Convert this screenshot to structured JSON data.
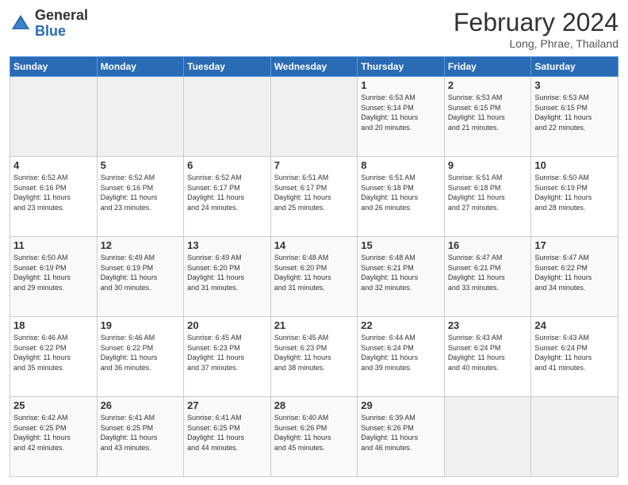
{
  "header": {
    "logo_general": "General",
    "logo_blue": "Blue",
    "month_title": "February 2024",
    "location": "Long, Phrae, Thailand"
  },
  "days_of_week": [
    "Sunday",
    "Monday",
    "Tuesday",
    "Wednesday",
    "Thursday",
    "Friday",
    "Saturday"
  ],
  "weeks": [
    [
      {
        "day": "",
        "info": "",
        "empty": true
      },
      {
        "day": "",
        "info": "",
        "empty": true
      },
      {
        "day": "",
        "info": "",
        "empty": true
      },
      {
        "day": "",
        "info": "",
        "empty": true
      },
      {
        "day": "1",
        "info": "Sunrise: 6:53 AM\nSunset: 6:14 PM\nDaylight: 11 hours\nand 20 minutes."
      },
      {
        "day": "2",
        "info": "Sunrise: 6:53 AM\nSunset: 6:15 PM\nDaylight: 11 hours\nand 21 minutes."
      },
      {
        "day": "3",
        "info": "Sunrise: 6:53 AM\nSunset: 6:15 PM\nDaylight: 11 hours\nand 22 minutes."
      }
    ],
    [
      {
        "day": "4",
        "info": "Sunrise: 6:52 AM\nSunset: 6:16 PM\nDaylight: 11 hours\nand 23 minutes."
      },
      {
        "day": "5",
        "info": "Sunrise: 6:52 AM\nSunset: 6:16 PM\nDaylight: 11 hours\nand 23 minutes."
      },
      {
        "day": "6",
        "info": "Sunrise: 6:52 AM\nSunset: 6:17 PM\nDaylight: 11 hours\nand 24 minutes."
      },
      {
        "day": "7",
        "info": "Sunrise: 6:51 AM\nSunset: 6:17 PM\nDaylight: 11 hours\nand 25 minutes."
      },
      {
        "day": "8",
        "info": "Sunrise: 6:51 AM\nSunset: 6:18 PM\nDaylight: 11 hours\nand 26 minutes."
      },
      {
        "day": "9",
        "info": "Sunrise: 6:51 AM\nSunset: 6:18 PM\nDaylight: 11 hours\nand 27 minutes."
      },
      {
        "day": "10",
        "info": "Sunrise: 6:50 AM\nSunset: 6:19 PM\nDaylight: 11 hours\nand 28 minutes."
      }
    ],
    [
      {
        "day": "11",
        "info": "Sunrise: 6:50 AM\nSunset: 6:19 PM\nDaylight: 11 hours\nand 29 minutes."
      },
      {
        "day": "12",
        "info": "Sunrise: 6:49 AM\nSunset: 6:19 PM\nDaylight: 11 hours\nand 30 minutes."
      },
      {
        "day": "13",
        "info": "Sunrise: 6:49 AM\nSunset: 6:20 PM\nDaylight: 11 hours\nand 31 minutes."
      },
      {
        "day": "14",
        "info": "Sunrise: 6:48 AM\nSunset: 6:20 PM\nDaylight: 11 hours\nand 31 minutes."
      },
      {
        "day": "15",
        "info": "Sunrise: 6:48 AM\nSunset: 6:21 PM\nDaylight: 11 hours\nand 32 minutes."
      },
      {
        "day": "16",
        "info": "Sunrise: 6:47 AM\nSunset: 6:21 PM\nDaylight: 11 hours\nand 33 minutes."
      },
      {
        "day": "17",
        "info": "Sunrise: 6:47 AM\nSunset: 6:22 PM\nDaylight: 11 hours\nand 34 minutes."
      }
    ],
    [
      {
        "day": "18",
        "info": "Sunrise: 6:46 AM\nSunset: 6:22 PM\nDaylight: 11 hours\nand 35 minutes."
      },
      {
        "day": "19",
        "info": "Sunrise: 6:46 AM\nSunset: 6:22 PM\nDaylight: 11 hours\nand 36 minutes."
      },
      {
        "day": "20",
        "info": "Sunrise: 6:45 AM\nSunset: 6:23 PM\nDaylight: 11 hours\nand 37 minutes."
      },
      {
        "day": "21",
        "info": "Sunrise: 6:45 AM\nSunset: 6:23 PM\nDaylight: 11 hours\nand 38 minutes."
      },
      {
        "day": "22",
        "info": "Sunrise: 6:44 AM\nSunset: 6:24 PM\nDaylight: 11 hours\nand 39 minutes."
      },
      {
        "day": "23",
        "info": "Sunrise: 6:43 AM\nSunset: 6:24 PM\nDaylight: 11 hours\nand 40 minutes."
      },
      {
        "day": "24",
        "info": "Sunrise: 6:43 AM\nSunset: 6:24 PM\nDaylight: 11 hours\nand 41 minutes."
      }
    ],
    [
      {
        "day": "25",
        "info": "Sunrise: 6:42 AM\nSunset: 6:25 PM\nDaylight: 11 hours\nand 42 minutes."
      },
      {
        "day": "26",
        "info": "Sunrise: 6:41 AM\nSunset: 6:25 PM\nDaylight: 11 hours\nand 43 minutes."
      },
      {
        "day": "27",
        "info": "Sunrise: 6:41 AM\nSunset: 6:25 PM\nDaylight: 11 hours\nand 44 minutes."
      },
      {
        "day": "28",
        "info": "Sunrise: 6:40 AM\nSunset: 6:26 PM\nDaylight: 11 hours\nand 45 minutes."
      },
      {
        "day": "29",
        "info": "Sunrise: 6:39 AM\nSunset: 6:26 PM\nDaylight: 11 hours\nand 46 minutes."
      },
      {
        "day": "",
        "info": "",
        "empty": true
      },
      {
        "day": "",
        "info": "",
        "empty": true
      }
    ]
  ]
}
